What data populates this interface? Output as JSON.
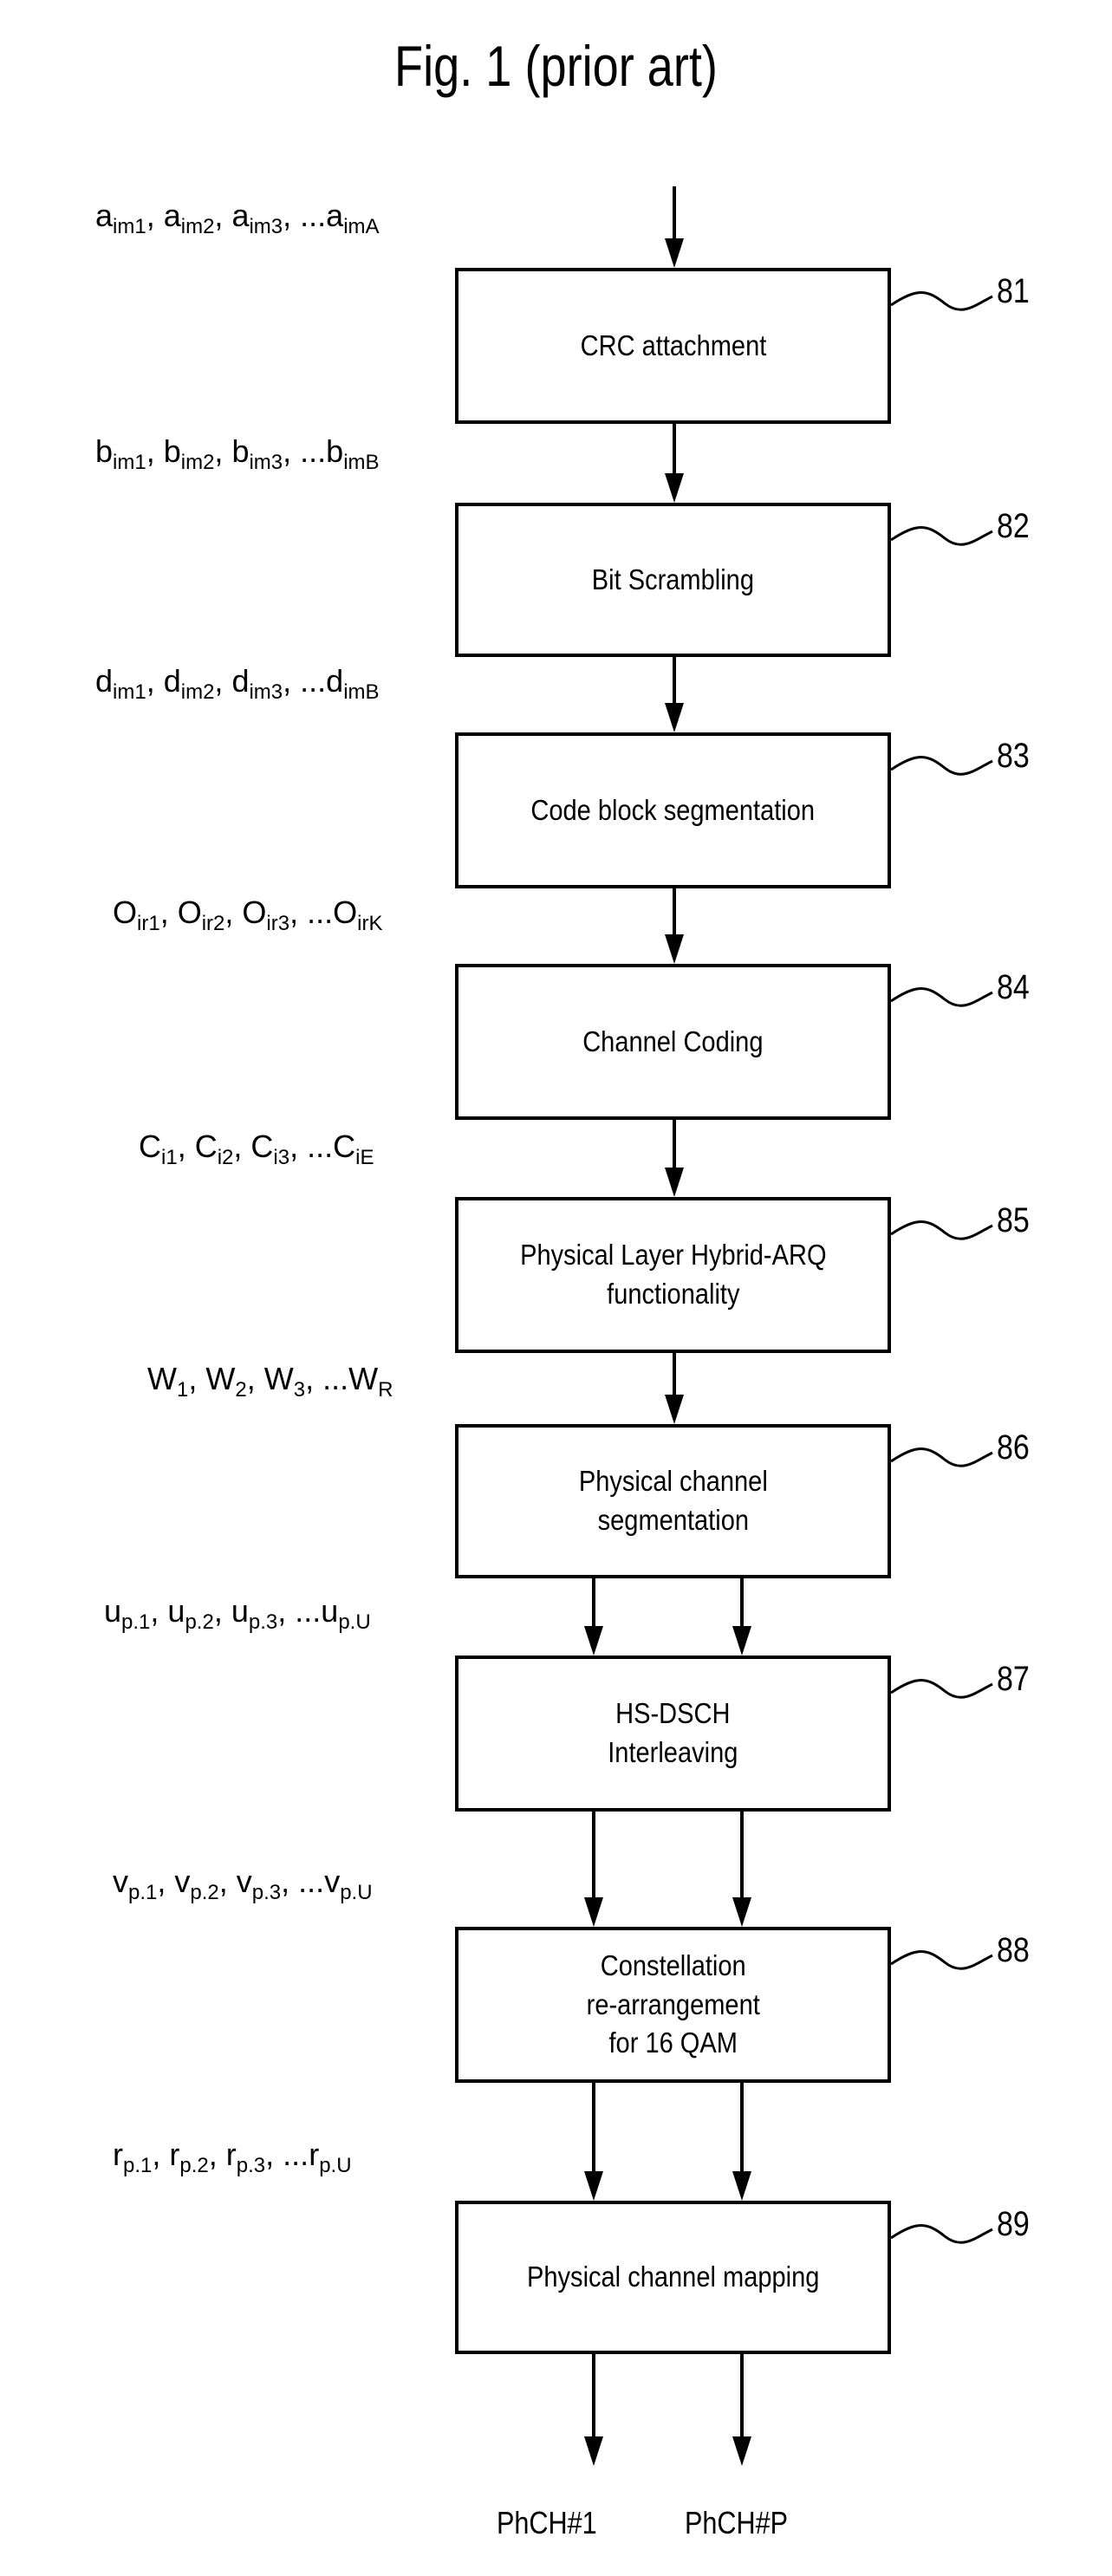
{
  "figure": {
    "title": "Fig. 1 (prior art)",
    "blocks": [
      {
        "ref": "81",
        "label": "CRC attachment",
        "input_sequence": {
          "base": "a",
          "terms": [
            "im1",
            "im2",
            "im3",
            "imA"
          ]
        }
      },
      {
        "ref": "82",
        "label": "Bit Scrambling",
        "input_sequence": {
          "base": "b",
          "terms": [
            "im1",
            "im2",
            "im3",
            "imB"
          ]
        }
      },
      {
        "ref": "83",
        "label": "Code block segmentation",
        "input_sequence": {
          "base": "d",
          "terms": [
            "im1",
            "im2",
            "im3",
            "imB"
          ]
        }
      },
      {
        "ref": "84",
        "label": "Channel Coding",
        "input_sequence": {
          "base": "O",
          "terms": [
            "ir1",
            "ir2",
            "ir3",
            "irK"
          ]
        }
      },
      {
        "ref": "85",
        "label": "Physical Layer Hybrid-ARQ\nfunctionality",
        "input_sequence": {
          "base": "C",
          "terms": [
            "i1",
            "i2",
            "i3",
            "iE"
          ]
        }
      },
      {
        "ref": "86",
        "label": "Physical  channel\nsegmentation",
        "input_sequence": {
          "base": "W",
          "terms": [
            "1",
            "2",
            "3",
            "R"
          ]
        }
      },
      {
        "ref": "87",
        "label": "HS-DSCH\nInterleaving",
        "input_sequence": {
          "base": "u",
          "terms": [
            "p.1",
            "p.2",
            "p.3",
            "p.U"
          ]
        }
      },
      {
        "ref": "88",
        "label": "Constellation\nre-arrangement\nfor 16 QAM",
        "input_sequence": {
          "base": "v",
          "terms": [
            "p.1",
            "p.2",
            "p.3",
            "p.U"
          ]
        }
      },
      {
        "ref": "89",
        "label": "Physical channel mapping",
        "input_sequence": {
          "base": "r",
          "terms": [
            "p.1",
            "p.2",
            "p.3",
            "p.U"
          ]
        }
      }
    ],
    "outputs": [
      "PhCH#1",
      "PhCH#P"
    ]
  }
}
